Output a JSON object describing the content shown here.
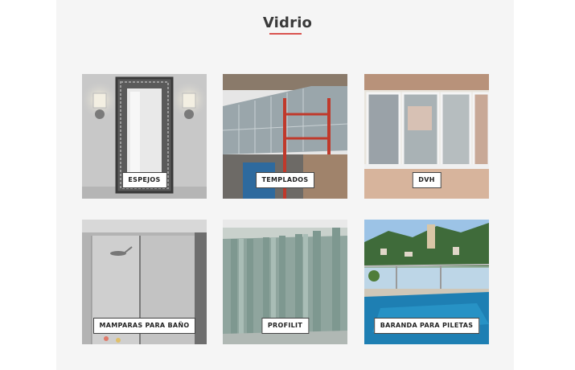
{
  "section": {
    "title": "Vidrio",
    "accent_color": "#d9534f"
  },
  "tiles": [
    {
      "label": "ESPEJOS",
      "image": "ornate-mirror"
    },
    {
      "label": "TEMPLADOS",
      "image": "glass-facade-building"
    },
    {
      "label": "DVH",
      "image": "double-glazed-window"
    },
    {
      "label": "MAMPARAS PARA BAÑO",
      "image": "glass-shower-screen"
    },
    {
      "label": "PROFILIT",
      "image": "channel-glass-wall"
    },
    {
      "label": "BARANDA PARA PILETAS",
      "image": "pool-glass-railing"
    }
  ]
}
